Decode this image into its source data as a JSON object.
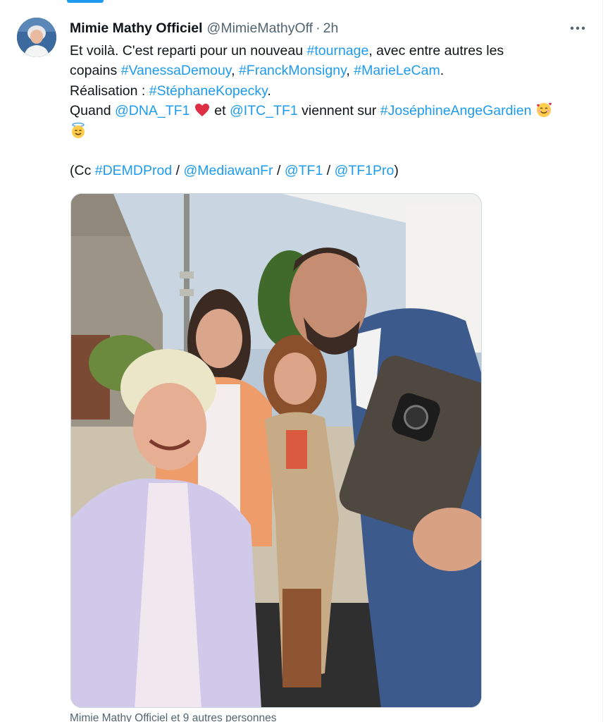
{
  "tweet": {
    "author_name": "Mimie Mathy Officiel",
    "author_handle": "@MimieMathyOff",
    "separator": "·",
    "time": "2h",
    "lines": {
      "l1_a": "Et voilà. C'est reparti pour un nouveau ",
      "l1_link": "#tournage",
      "l1_b": ", avec entre autres les",
      "l2_a": "copains ",
      "l2_link1": "#VanessaDemouy",
      "l2_sep1": ", ",
      "l2_link2": "#FranckMonsigny",
      "l2_sep2": ", ",
      "l2_link3": "#MarieLeCam",
      "l2_end": ".",
      "l3_a": "Réalisation : ",
      "l3_link": "#StéphaneKopecky",
      "l3_end": ".",
      "l4_a": "Quand ",
      "l4_link1": "@DNA_TF1",
      "l4_b": " et ",
      "l4_link2": "@ITC_TF1",
      "l4_c": " viennent sur ",
      "l4_link3": "#JoséphineAngeGardien",
      "l6_a": "(Cc ",
      "l6_link1": "#DEMDProd",
      "l6_sep1": " / ",
      "l6_link2": "@MediawanFr",
      "l6_sep2": " / ",
      "l6_link3": "@TF1",
      "l6_sep3": " / ",
      "l6_link4": "@TF1Pro",
      "l6_end": ")"
    },
    "emojis": [
      "red-heart",
      "smiling-face-with-hearts",
      "smiling-face-with-halo"
    ],
    "tagged_people": "Mimie Mathy Officiel et 9 autres personnes"
  },
  "colors": {
    "link": "#1d9bf0",
    "text": "#0f1419",
    "secondary": "#536471"
  }
}
